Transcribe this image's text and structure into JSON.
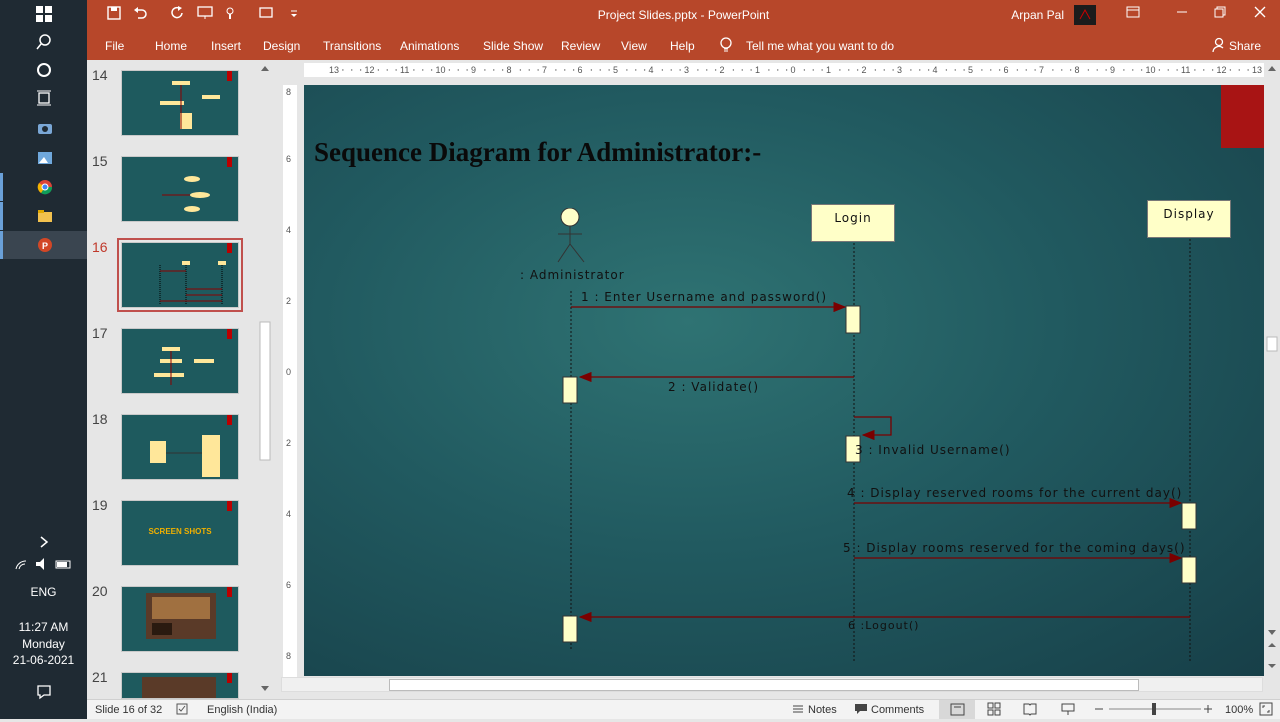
{
  "window": {
    "title": "Project Slides.pptx  -  PowerPoint",
    "user": "Arpan Pal"
  },
  "menu": {
    "file": "File",
    "home": "Home",
    "insert": "Insert",
    "design": "Design",
    "transitions": "Transitions",
    "animations": "Animations",
    "slideshow": "Slide Show",
    "review": "Review",
    "view": "View",
    "help": "Help",
    "tellme": "Tell me what you want to do",
    "share": "Share"
  },
  "thumbnails": [
    {
      "num": "14",
      "selected": false
    },
    {
      "num": "15",
      "selected": false
    },
    {
      "num": "16",
      "selected": true
    },
    {
      "num": "17",
      "selected": false
    },
    {
      "num": "18",
      "selected": false
    },
    {
      "num": "19",
      "selected": false,
      "text": "SCREEN SHOTS"
    },
    {
      "num": "20",
      "selected": false
    },
    {
      "num": "21",
      "selected": false
    }
  ],
  "slide": {
    "title": "Sequence Diagram for Administrator:-",
    "actor": ": Administrator",
    "lifeline_login": "Login",
    "lifeline_display": "Display",
    "messages": [
      "1 : Enter Username  and password()",
      "2 : Validate()",
      "3 : Invalid Username()",
      "4 : Display reserved rooms for the current day()",
      "5 : Display rooms reserved for the coming days()",
      "6 :Logout()"
    ]
  },
  "ruler_h": [
    "13",
    "12",
    "11",
    "10",
    "9",
    "8",
    "7",
    "6",
    "5",
    "4",
    "3",
    "2",
    "1",
    "0",
    "1",
    "2",
    "3",
    "4",
    "5",
    "6",
    "7",
    "8",
    "9",
    "10",
    "11",
    "12",
    "13"
  ],
  "status": {
    "slide": "Slide 16 of 32",
    "language": "English (India)",
    "notes": "Notes",
    "comments": "Comments",
    "zoom": "100%"
  },
  "taskbar": {
    "lang": "ENG",
    "time": "11:27 AM",
    "day": "Monday",
    "date": "21-06-2021"
  },
  "colors": {
    "accent": "#b7472a",
    "slide_bg": "#215a60",
    "box_fill": "#ffffc8",
    "arrow": "#8b0000"
  }
}
